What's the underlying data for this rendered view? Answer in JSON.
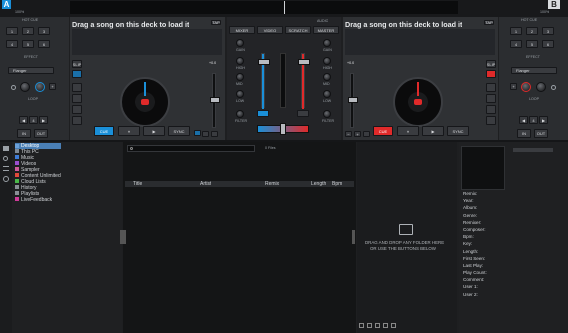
{
  "top_bar": {
    "deck_a_letter": "A",
    "deck_b_letter": "B",
    "deck_a_pct": "100%",
    "deck_b_pct": "100%"
  },
  "colors": {
    "deck_a_accent": "#1a8fd8",
    "deck_b_accent": "#e02a2a",
    "cue_left": "#1a8fd8",
    "cue_right": "#e02a2a"
  },
  "left_side": {
    "hot_cue_label": "HOT CUE",
    "pads": [
      "1",
      "2",
      "3",
      "4",
      "5",
      "6"
    ],
    "effect_label": "EFFECT",
    "effect_value": "Flanger",
    "loop_label": "LOOP",
    "in_label": "IN",
    "out_label": "OUT"
  },
  "right_side": {
    "hot_cue_label": "HOT CUE",
    "pads": [
      "1",
      "2",
      "3",
      "4",
      "5",
      "6"
    ],
    "effect_label": "EFFECT",
    "effect_value": "Flanger",
    "loop_label": "LOOP",
    "in_label": "IN",
    "out_label": "OUT"
  },
  "deck_left": {
    "title": "Drag a song on this deck to load it",
    "pitch": "+0.0",
    "cue": "CUE",
    "play": "▶",
    "pause": "⏸",
    "sync": "SYNC",
    "keylock": "KEYLOCK"
  },
  "deck_right": {
    "title": "Drag a song on this deck to load it",
    "pitch": "+0.0",
    "cue": "CUE",
    "play": "▶",
    "pause": "⏸",
    "sync": "SYNC",
    "keylock": "KEYLOCK"
  },
  "mixer": {
    "tabs": [
      "MIXER",
      "VIDEO",
      "SCRATCH",
      "MASTER"
    ],
    "channel_labels": [
      "GAIN",
      "HIGH",
      "MID",
      "LOW",
      "FILTER"
    ],
    "audio_label": "AUDIO"
  },
  "browser": {
    "tree": [
      "Desktop",
      "This PC",
      "Music",
      "Videos",
      "Sampler",
      "Content Unlimited",
      "Cloud Lists",
      "History",
      "Playlists",
      "LiveFeedback"
    ],
    "files_count": "0 Files",
    "columns": [
      "Title",
      "Artist",
      "Remix",
      "Length",
      "Bpm"
    ],
    "drop_hint_1": "DRAG AND DROP ANY FOLDER HERE",
    "drop_hint_2": "OR USE THE BUTTONS BELOW"
  },
  "info_panel": {
    "fields": [
      "Remix:",
      "Year:",
      "Album:",
      "Genre:",
      "Remixer:",
      "Composer:",
      "Bpm:",
      "Key:",
      "Length:",
      "First Seen:",
      "Last Play:",
      "Play Count:",
      "Comment:",
      "User 1:",
      "User 2:"
    ]
  }
}
